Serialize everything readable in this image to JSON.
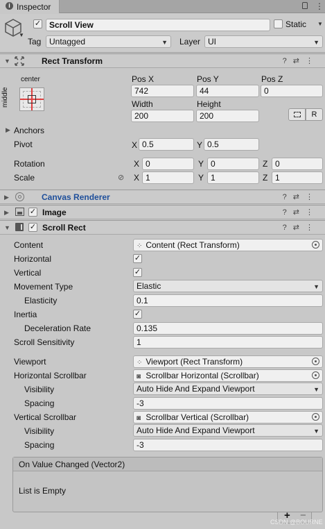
{
  "tab": {
    "icon": "info-icon",
    "label": "Inspector",
    "lock": "lock-icon",
    "menu": "kebab-menu-icon"
  },
  "object": {
    "active": true,
    "name": "Scroll View",
    "static_label": "Static",
    "static_checked": false,
    "tag_label": "Tag",
    "tag_value": "Untagged",
    "layer_label": "Layer",
    "layer_value": "UI"
  },
  "rect_transform": {
    "title": "Rect Transform",
    "anchor_h": "center",
    "anchor_v": "middle",
    "pos_x_label": "Pos X",
    "pos_x": "742",
    "pos_y_label": "Pos Y",
    "pos_y": "44",
    "pos_z_label": "Pos Z",
    "pos_z": "0",
    "width_label": "Width",
    "width": "200",
    "height_label": "Height",
    "height": "200",
    "r_button": "R",
    "anchors_label": "Anchors",
    "pivot_label": "Pivot",
    "pivot_x_label": "X",
    "pivot_x": "0.5",
    "pivot_y_label": "Y",
    "pivot_y": "0.5",
    "rotation_label": "Rotation",
    "rot_x": "0",
    "rot_y": "0",
    "rot_z": "0",
    "scale_label": "Scale",
    "scale_x": "1",
    "scale_y": "1",
    "scale_z": "1",
    "x": "X",
    "y": "Y",
    "z": "Z"
  },
  "canvas_renderer": {
    "title": "Canvas Renderer"
  },
  "image": {
    "title": "Image",
    "enabled": true
  },
  "scroll_rect": {
    "title": "Scroll Rect",
    "enabled": true,
    "content_label": "Content",
    "content_value": "Content (Rect Transform)",
    "horizontal_label": "Horizontal",
    "horizontal": true,
    "vertical_label": "Vertical",
    "vertical": true,
    "movement_label": "Movement Type",
    "movement_value": "Elastic",
    "elasticity_label": "Elasticity",
    "elasticity_value": "0.1",
    "inertia_label": "Inertia",
    "inertia": true,
    "decel_label": "Deceleration Rate",
    "decel_value": "0.135",
    "sensitivity_label": "Scroll Sensitivity",
    "sensitivity_value": "1",
    "viewport_label": "Viewport",
    "viewport_value": "Viewport (Rect Transform)",
    "hscroll_label": "Horizontal Scrollbar",
    "hscroll_value": "Scrollbar Horizontal (Scrollbar)",
    "hvis_label": "Visibility",
    "hvis_value": "Auto Hide And Expand Viewport",
    "hspacing_label": "Spacing",
    "hspacing_value": "-3",
    "vscroll_label": "Vertical Scrollbar",
    "vscroll_value": "Scrollbar Vertical (Scrollbar)",
    "vvis_label": "Visibility",
    "vvis_value": "Auto Hide And Expand Viewport",
    "vspacing_label": "Spacing",
    "vspacing_value": "-3",
    "event_title": "On Value Changed (Vector2)",
    "event_empty": "List is Empty",
    "add": "+",
    "remove": "−"
  },
  "watermark": "CSDN @BOURNE"
}
